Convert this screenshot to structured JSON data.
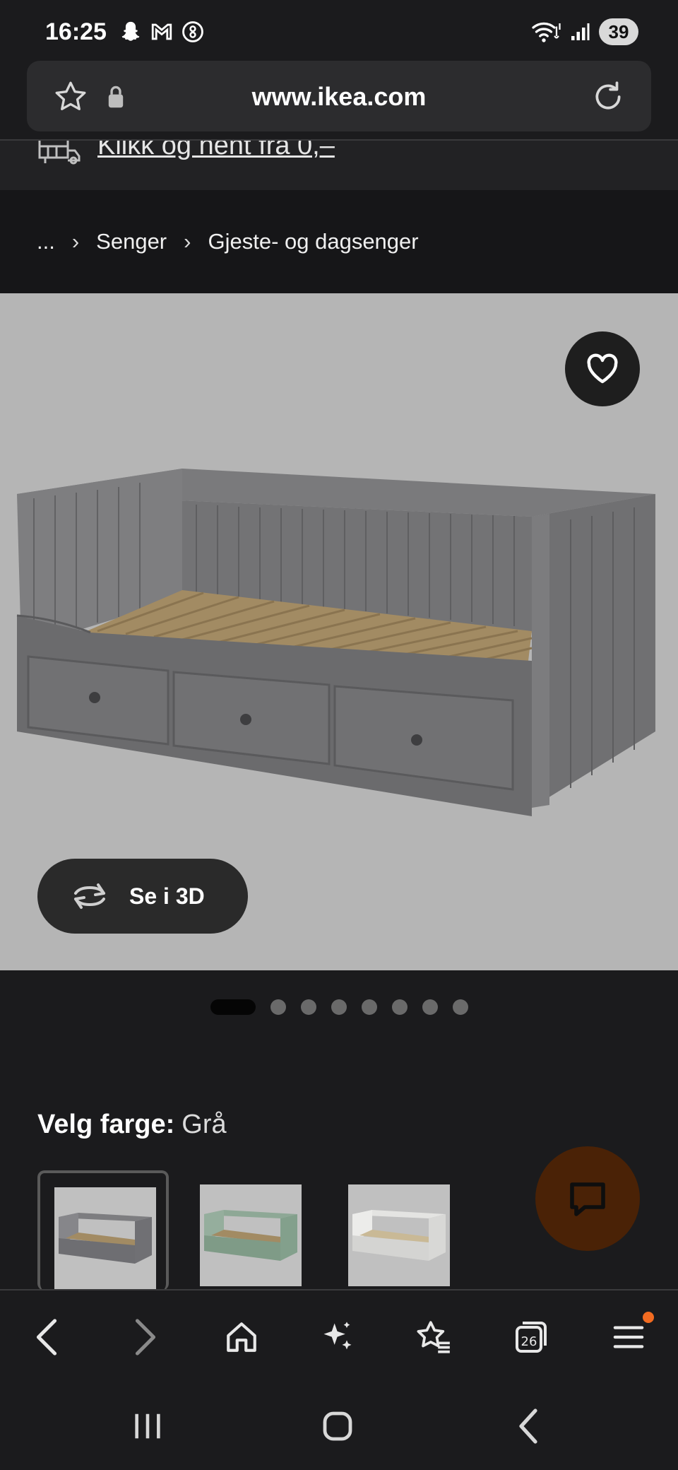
{
  "status_bar": {
    "time": "16:25",
    "battery": "39",
    "left_icons": [
      "snapchat-icon",
      "gmail-icon",
      "assistant-icon"
    ],
    "right_icons": [
      "wifi-icon",
      "signal-icon",
      "battery-icon"
    ]
  },
  "url_bar": {
    "url": "www.ikea.com",
    "icons": [
      "star-icon",
      "lock-icon",
      "reload-icon"
    ]
  },
  "pickup": {
    "text": "Klikk og hent fra 0,–"
  },
  "breadcrumb": {
    "ellipsis": "...",
    "items": [
      "Senger",
      "Gjeste- og dagsenger"
    ]
  },
  "product": {
    "view_3d_label": "Se i 3D",
    "carousel_total": 8,
    "carousel_active": 1
  },
  "color_select": {
    "label": "Velg farge:",
    "value": "Grå",
    "swatch_colors": [
      "#7d7d80",
      "#8ea896",
      "#e4e4e2"
    ]
  },
  "colors": {
    "accent": "#f26b21",
    "chat_fab": "#4a2206",
    "background": "#1b1b1d"
  },
  "browser_nav": {
    "tab_count": "26",
    "items": [
      "back-icon",
      "forward-icon",
      "home-icon",
      "ai-sparkle-icon",
      "bookmarks-icon",
      "tabs-icon",
      "menu-icon"
    ]
  }
}
